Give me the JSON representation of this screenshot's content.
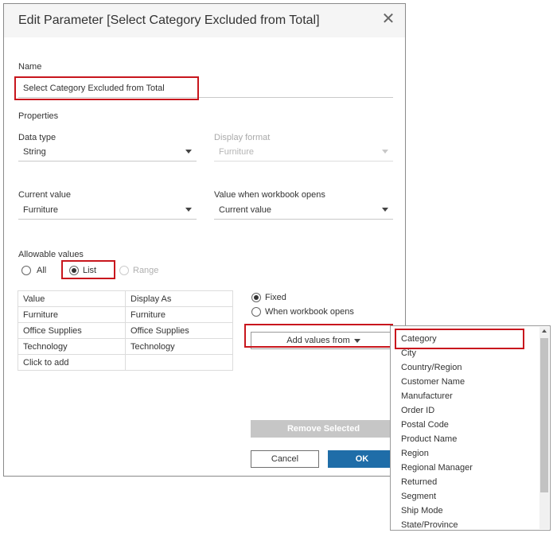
{
  "dialog": {
    "title": "Edit Parameter [Select Category Excluded from Total]",
    "close_icon": "close-icon"
  },
  "name": {
    "label": "Name",
    "value": "Select Category Excluded from Total"
  },
  "properties": {
    "heading": "Properties",
    "data_type_label": "Data type",
    "data_type_value": "String",
    "display_format_label": "Display format",
    "display_format_value": "Furniture",
    "current_value_label": "Current value",
    "current_value_value": "Furniture",
    "workbook_opens_label": "Value when workbook opens",
    "workbook_opens_value": "Current value"
  },
  "allowable": {
    "label": "Allowable values",
    "options": [
      "All",
      "List",
      "Range"
    ],
    "selected": "List"
  },
  "values_table": {
    "headers": [
      "Value",
      "Display As"
    ],
    "rows": [
      [
        "Furniture",
        "Furniture"
      ],
      [
        "Office Supplies",
        "Office Supplies"
      ],
      [
        "Technology",
        "Technology"
      ]
    ],
    "add_row": "Click to add"
  },
  "list_source": {
    "options": [
      "Fixed",
      "When workbook opens"
    ],
    "selected": "Fixed"
  },
  "buttons": {
    "add_values": "Add values from",
    "remove_selected": "Remove Selected",
    "cancel": "Cancel",
    "ok": "OK"
  },
  "dropdown": {
    "items": [
      "Category",
      "City",
      "Country/Region",
      "Customer Name",
      "Manufacturer",
      "Order ID",
      "Postal Code",
      "Product Name",
      "Region",
      "Regional Manager",
      "Returned",
      "Segment",
      "Ship Mode",
      "State/Province"
    ],
    "highlighted": "Category"
  },
  "colors": {
    "highlight_border": "#c8161d",
    "ok_button": "#1f6da8",
    "disabled_button": "#c6c6c6"
  }
}
